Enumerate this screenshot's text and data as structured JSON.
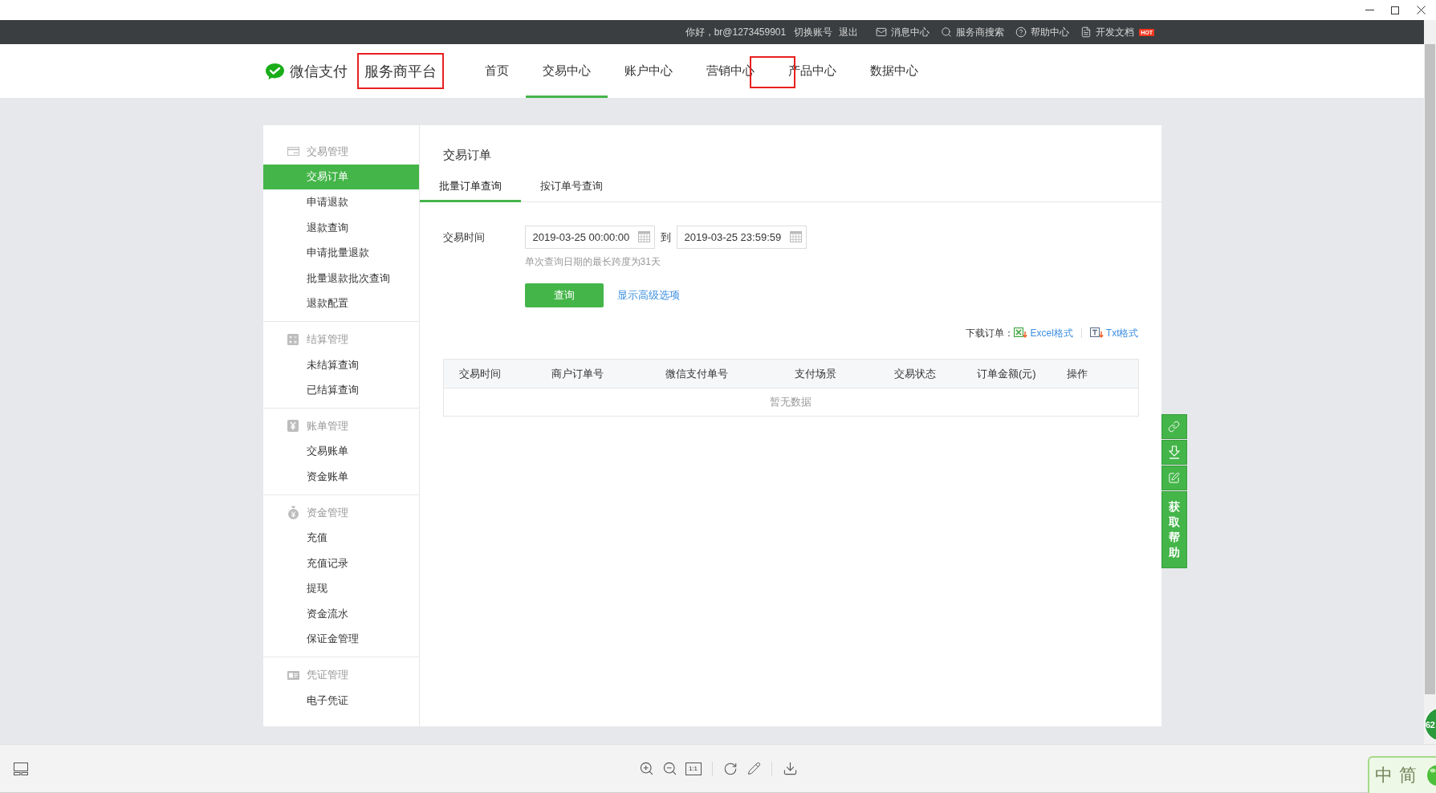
{
  "top_bar": {
    "greeting": "你好，br@1273459901",
    "account_links": [
      "切换账号",
      "退出"
    ],
    "tools": [
      {
        "label": "消息中心"
      },
      {
        "label": "服务商搜索"
      },
      {
        "label": "帮助中心"
      },
      {
        "label": "开发文档",
        "badge": "HOT"
      }
    ]
  },
  "header": {
    "logo_text": "微信支付",
    "platform": {
      "label": "服务商平台",
      "highlighted": true
    },
    "nav": [
      {
        "label": "首页",
        "selected": false,
        "highlighted": false
      },
      {
        "label": "交易中心",
        "selected": true,
        "highlighted": false
      },
      {
        "label": "账户中心",
        "selected": false,
        "highlighted": false
      },
      {
        "label": "营销中心",
        "selected": false,
        "highlighted": false
      },
      {
        "label": "产品中心",
        "selected": false,
        "highlighted": true
      },
      {
        "label": "数据中心",
        "selected": false,
        "highlighted": false
      }
    ]
  },
  "sidebar": {
    "groups": [
      {
        "title": "交易管理",
        "items": [
          {
            "label": "交易订单",
            "selected": true
          },
          {
            "label": "申请退款",
            "selected": false
          },
          {
            "label": "退款查询",
            "selected": false
          },
          {
            "label": "申请批量退款",
            "selected": false
          },
          {
            "label": "批量退款批次查询",
            "selected": false
          },
          {
            "label": "退款配置",
            "selected": false
          }
        ]
      },
      {
        "title": "结算管理",
        "items": [
          {
            "label": "未结算查询",
            "selected": false
          },
          {
            "label": "已结算查询",
            "selected": false
          }
        ]
      },
      {
        "title": "账单管理",
        "items": [
          {
            "label": "交易账单",
            "selected": false
          },
          {
            "label": "资金账单",
            "selected": false
          }
        ]
      },
      {
        "title": "资金管理",
        "items": [
          {
            "label": "充值",
            "selected": false
          },
          {
            "label": "充值记录",
            "selected": false
          },
          {
            "label": "提现",
            "selected": false
          },
          {
            "label": "资金流水",
            "selected": false
          },
          {
            "label": "保证金管理",
            "selected": false
          }
        ]
      },
      {
        "title": "凭证管理",
        "items": [
          {
            "label": "电子凭证",
            "selected": false
          }
        ]
      }
    ]
  },
  "content": {
    "title": "交易订单",
    "tabs": [
      {
        "label": "批量订单查询",
        "selected": true
      },
      {
        "label": "按订单号查询",
        "selected": false
      }
    ],
    "form": {
      "label": "交易时间",
      "start_time": "2019-03-25 00:00:00",
      "separator": "到",
      "end_time": "2019-03-25 23:59:59",
      "hint": "单次查询日期的最长跨度为31天",
      "submit": "查询",
      "advanced_link": "显示高级选项"
    },
    "download": {
      "label": "下载订单：",
      "links": [
        "Excel格式",
        "Txt格式"
      ]
    },
    "table": {
      "columns": [
        "交易时间",
        "商户订单号",
        "微信支付单号",
        "支付场景",
        "交易状态",
        "订单金额(元)",
        "操作"
      ],
      "empty_text": "暂无数据"
    }
  },
  "side_tools": {
    "help_label": "获取帮助"
  },
  "viewer_toolbar": {
    "actual_size": "1:1"
  },
  "ime": {
    "labels": [
      "中",
      "简"
    ]
  },
  "speed_ball": {
    "value": "62"
  }
}
